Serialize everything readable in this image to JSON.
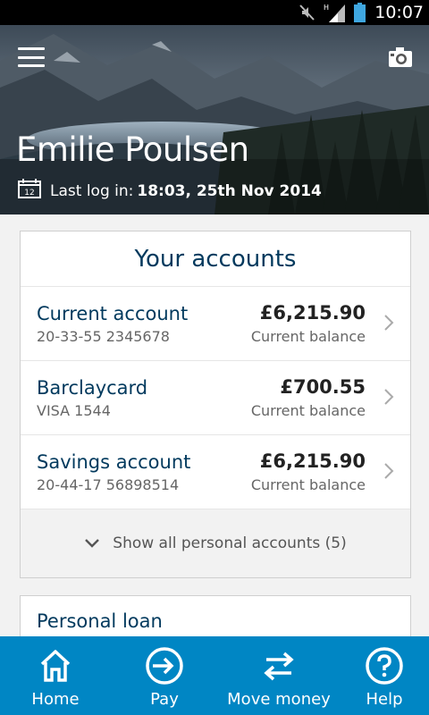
{
  "status_bar": {
    "time": "10:07",
    "icons": [
      "mute-icon",
      "hspa-signal-icon",
      "battery-icon"
    ]
  },
  "header": {
    "user_name": "Emilie Poulsen",
    "last_login_label": "Last log in:",
    "last_login_value": "18:03, 25th Nov 2014",
    "calendar_day": "12",
    "icons": [
      "menu-icon",
      "camera-icon",
      "calendar-icon"
    ]
  },
  "accounts": {
    "title": "Your accounts",
    "items": [
      {
        "name": "Current account",
        "detail": "20-33-55  2345678",
        "amount": "£6,215.90",
        "balance_label": "Current balance"
      },
      {
        "name": "Barclaycard",
        "detail": "VISA 1544",
        "amount": "£700.55",
        "balance_label": "Current balance"
      },
      {
        "name": "Savings account",
        "detail": "20-44-17  56898514",
        "amount": "£6,215.90",
        "balance_label": "Current balance"
      }
    ],
    "show_all": "Show all personal accounts (5)"
  },
  "loan": {
    "name": "Personal loan"
  },
  "nav": {
    "items": [
      {
        "label": "Home",
        "icon": "home-icon"
      },
      {
        "label": "Pay",
        "icon": "pay-icon"
      },
      {
        "label": "Move money",
        "icon": "transfer-icon"
      },
      {
        "label": "Help",
        "icon": "help-icon"
      }
    ]
  },
  "colors": {
    "brand_dark": "#00395d",
    "nav_blue": "#0086c4",
    "background": "#f2f2f2"
  }
}
